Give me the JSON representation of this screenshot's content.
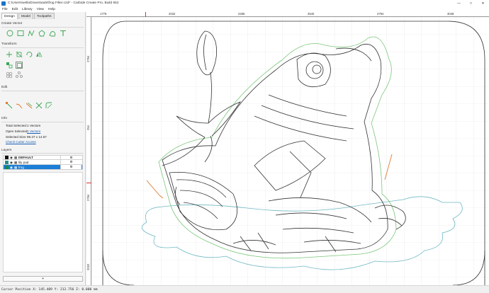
{
  "window": {
    "title": "C:\\Users\\wella\\Downloads\\frog Filter.c2d* - Carbide Create Pro, Build 652",
    "minimize": "—",
    "maximize": "□",
    "close": "✕"
  },
  "menu": [
    "File",
    "Edit",
    "Library",
    "View",
    "Help"
  ],
  "tabs": [
    "Design",
    "Model",
    "Toolpaths"
  ],
  "sections": {
    "create_vector": "Create Vector",
    "transform": "Transform",
    "edit": "Edit",
    "info": "Info",
    "layers": "Layers"
  },
  "info": {
    "total_selected_label": "Total Selected:",
    "total_selected_value": "1 Vectors",
    "open_selected_label": "Open Selected:",
    "open_selected_value": "1 Vectors",
    "selected_size_label": "Selected Size:",
    "selected_size_value": "99.37 x 14.67",
    "check_cutter": "Check Cutter Access"
  },
  "layers": [
    {
      "name": "DEFAULT",
      "color": "#111111",
      "selected": false,
      "bold": true
    },
    {
      "name": "lily pad",
      "color": "#2a8a86",
      "selected": false,
      "bold": false
    },
    {
      "name": "frog",
      "color": "#138a44",
      "selected": true,
      "bold": false
    }
  ],
  "add_layer": "+",
  "ruler": {
    "top": [
      "1778",
      "2032",
      "2286",
      "2540",
      "2794",
      "3048"
    ],
    "left": [
      "2794",
      "254",
      "2794",
      "2032"
    ]
  },
  "status": {
    "text": "Cursor Position X: 145.409 Y: 212.756 Z: 0.000 mm"
  },
  "colors": {
    "accent": "#1c7ed6",
    "vector_green": "#7ac77a",
    "lily_pad": "#6fb8c4",
    "cut_orange": "#e07a30",
    "frog_line": "#333333"
  }
}
